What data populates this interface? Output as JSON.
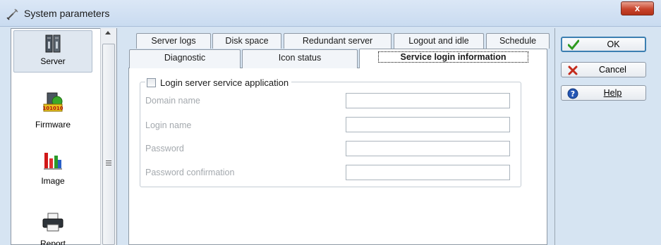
{
  "window": {
    "title": "System parameters",
    "close_label": "x"
  },
  "nav": {
    "items": [
      {
        "label": "Server",
        "icon": "server-icon",
        "selected": true
      },
      {
        "label": "Firmware",
        "icon": "firmware-icon",
        "selected": false
      },
      {
        "label": "Image",
        "icon": "image-chart-icon",
        "selected": false
      },
      {
        "label": "Report",
        "icon": "printer-icon",
        "selected": false
      }
    ]
  },
  "tabs": {
    "row1": [
      "Server logs",
      "Disk space",
      "Redundant server",
      "Logout and idle",
      "Schedule"
    ],
    "row2": [
      "Diagnostic",
      "Icon status",
      "Service login information"
    ],
    "active": "Service login information"
  },
  "group": {
    "checkbox_label": "Login server service application",
    "checked": false,
    "fields": [
      {
        "label": "Domain name",
        "value": ""
      },
      {
        "label": "Login name",
        "value": ""
      },
      {
        "label": "Password",
        "value": ""
      },
      {
        "label": "Password confirmation",
        "value": ""
      }
    ]
  },
  "buttons": {
    "ok": "OK",
    "cancel": "Cancel",
    "help": "Help"
  },
  "colors": {
    "accent": "#3c7fb1",
    "ok_check": "#2e9a1f",
    "cancel_x": "#c42b1c",
    "help_icon": "#2456b5"
  }
}
